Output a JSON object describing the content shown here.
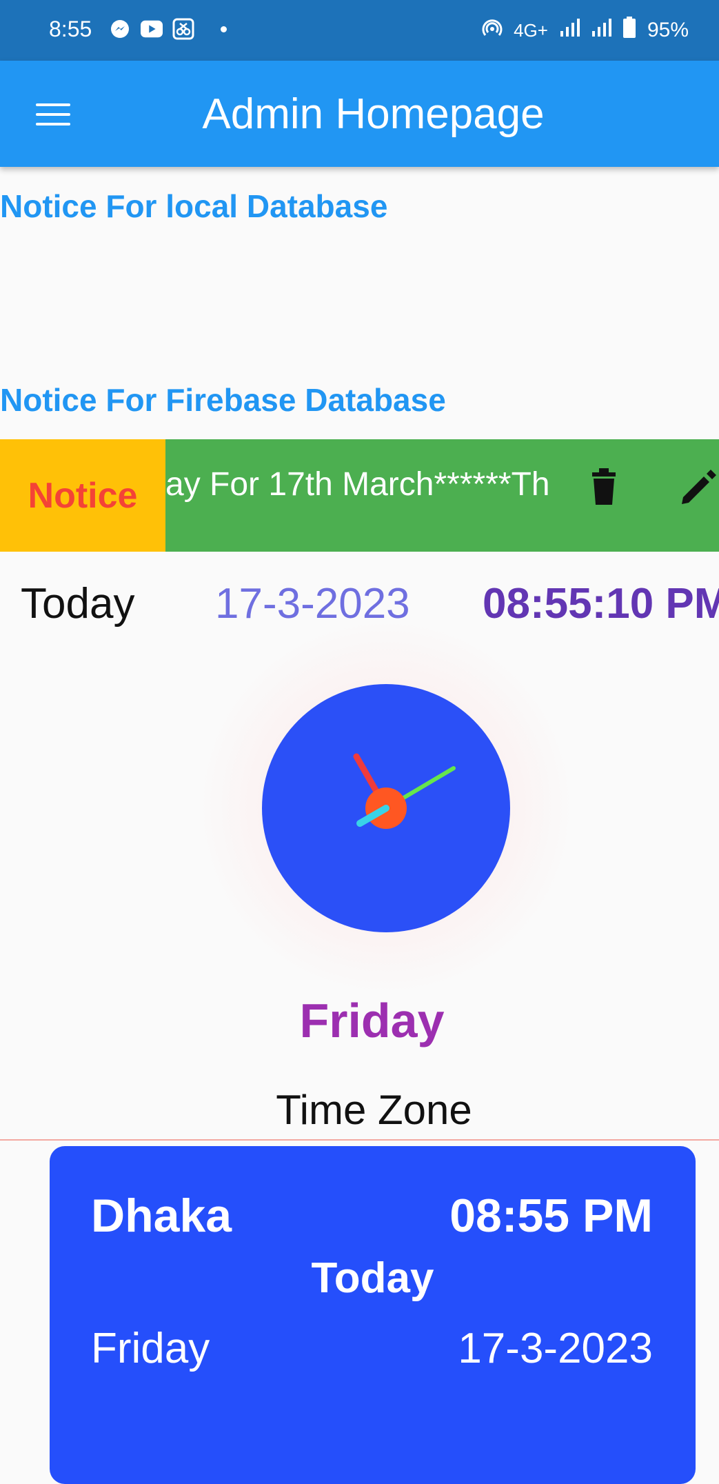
{
  "status_bar": {
    "time": "8:55",
    "network": "4G+",
    "battery": "95%"
  },
  "app_bar": {
    "title": "Admin Homepage"
  },
  "sections": {
    "local_title": "Notice For local Database",
    "firebase_title": "Notice For Firebase Database"
  },
  "notice": {
    "label": "Notice",
    "text": "ay For 17th March******Th",
    "colors": {
      "row": "#4caf50",
      "label_bg": "#ffc107",
      "label_text": "#f44336"
    }
  },
  "today": {
    "label": "Today",
    "date": "17-3-2023",
    "time": "08:55:10 PM"
  },
  "clock": {
    "face_color": "#2b50f7",
    "center_color": "#ff5722"
  },
  "day_name": "Friday",
  "time_zone": {
    "title": "Time Zone",
    "card": {
      "city": "Dhaka",
      "time": "08:55 PM",
      "today": "Today",
      "day": "Friday",
      "date": "17-3-2023"
    }
  }
}
